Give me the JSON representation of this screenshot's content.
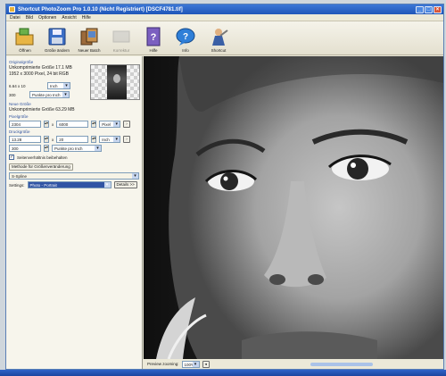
{
  "window": {
    "title": "Shortcut PhotoZoom Pro 1.0.10 (Nicht Registriert)   [DSCF4781.tif]"
  },
  "menu": [
    "Datei",
    "Bild",
    "Optionen",
    "Ansicht",
    "Hilfe"
  ],
  "toolbar": [
    {
      "label": "Öffnen",
      "icon": "open-folder-icon",
      "enabled": true
    },
    {
      "label": "Größe ändern",
      "icon": "floppy-save-icon",
      "enabled": true
    },
    {
      "label": "Neuer Batch",
      "icon": "batch-icon",
      "enabled": true
    },
    {
      "label": "Korrektur",
      "icon": "disabled-tool-icon",
      "enabled": false
    },
    {
      "label": "Hilfe",
      "icon": "help-book-icon",
      "enabled": true
    },
    {
      "label": "Info",
      "icon": "info-bubble-icon",
      "enabled": true
    },
    {
      "label": "Shortcut",
      "icon": "shortcut-logo-icon",
      "enabled": true
    }
  ],
  "original": {
    "section": "Originalgröße",
    "uncompressed": "Unkomprimierte Größe 17.1 MB",
    "pixels": "1952 x 3000 Pixel, 24 bit RGB",
    "size_value": "6.64 x 10",
    "size_unit": "Inch",
    "resolution": "300",
    "resolution_unit": "Punkte pro Inch"
  },
  "new_size": {
    "section": "Neue Größe",
    "uncompressed": "Unkomprimierte Größe 63.29 MB",
    "pixel_label": "Pixelgröße",
    "pixel_w": "2304",
    "pixel_h": "6000",
    "pixel_unit": "Pixel",
    "print_label": "Druckgröße",
    "print_w": "13.28",
    "print_h": "20",
    "print_unit": "Inch",
    "dpi": "300",
    "dpi_unit": "Punkte pro Inch",
    "keep_ratio_label": "Seitenverhältnis beibehalten"
  },
  "method": {
    "label": "Methode für Größenveränderung",
    "value": "S-Spline",
    "settings_label": "Settings:",
    "settings_value": "Photo - Portrait",
    "details_btn": "Details >>"
  },
  "status": {
    "zoom_label": "Preview zooming:",
    "zoom_value": "100%"
  }
}
